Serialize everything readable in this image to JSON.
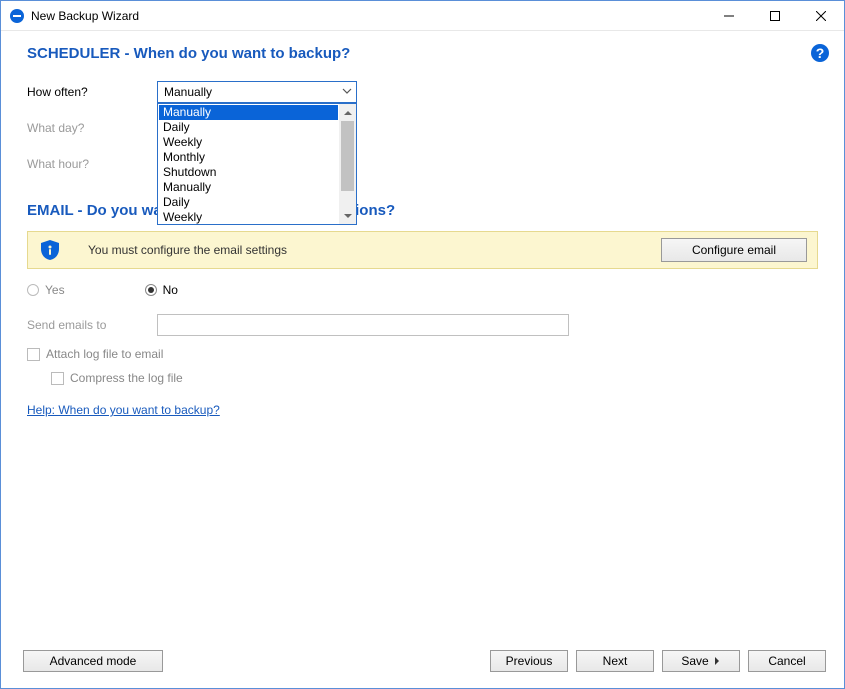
{
  "window": {
    "title": "New Backup Wizard"
  },
  "scheduler": {
    "heading": "SCHEDULER - When do you want to backup?",
    "howOftenLabel": "How often?",
    "howOftenValue": "Manually",
    "whatDayLabel": "What day?",
    "whatHourLabel": "What hour?",
    "dropdown": {
      "items": [
        "Manually",
        "Daily",
        "Weekly",
        "Monthly",
        "Shutdown",
        "Manually",
        "Daily",
        "Weekly"
      ],
      "selectedIndex": 0
    }
  },
  "email": {
    "heading": "EMAIL - Do you want to receive email notifications?",
    "bannerMsg": "You must configure the email settings",
    "configureBtn": "Configure email",
    "yesLabel": "Yes",
    "noLabel": "No",
    "sendToLabel": "Send emails to",
    "sendToValue": "",
    "attachLogLabel": "Attach log file to email",
    "compressLogLabel": "Compress the log file",
    "helpLink": "Help: When do you want to backup?"
  },
  "footer": {
    "advanced": "Advanced mode",
    "previous": "Previous",
    "next": "Next",
    "save": "Save",
    "cancel": "Cancel"
  }
}
